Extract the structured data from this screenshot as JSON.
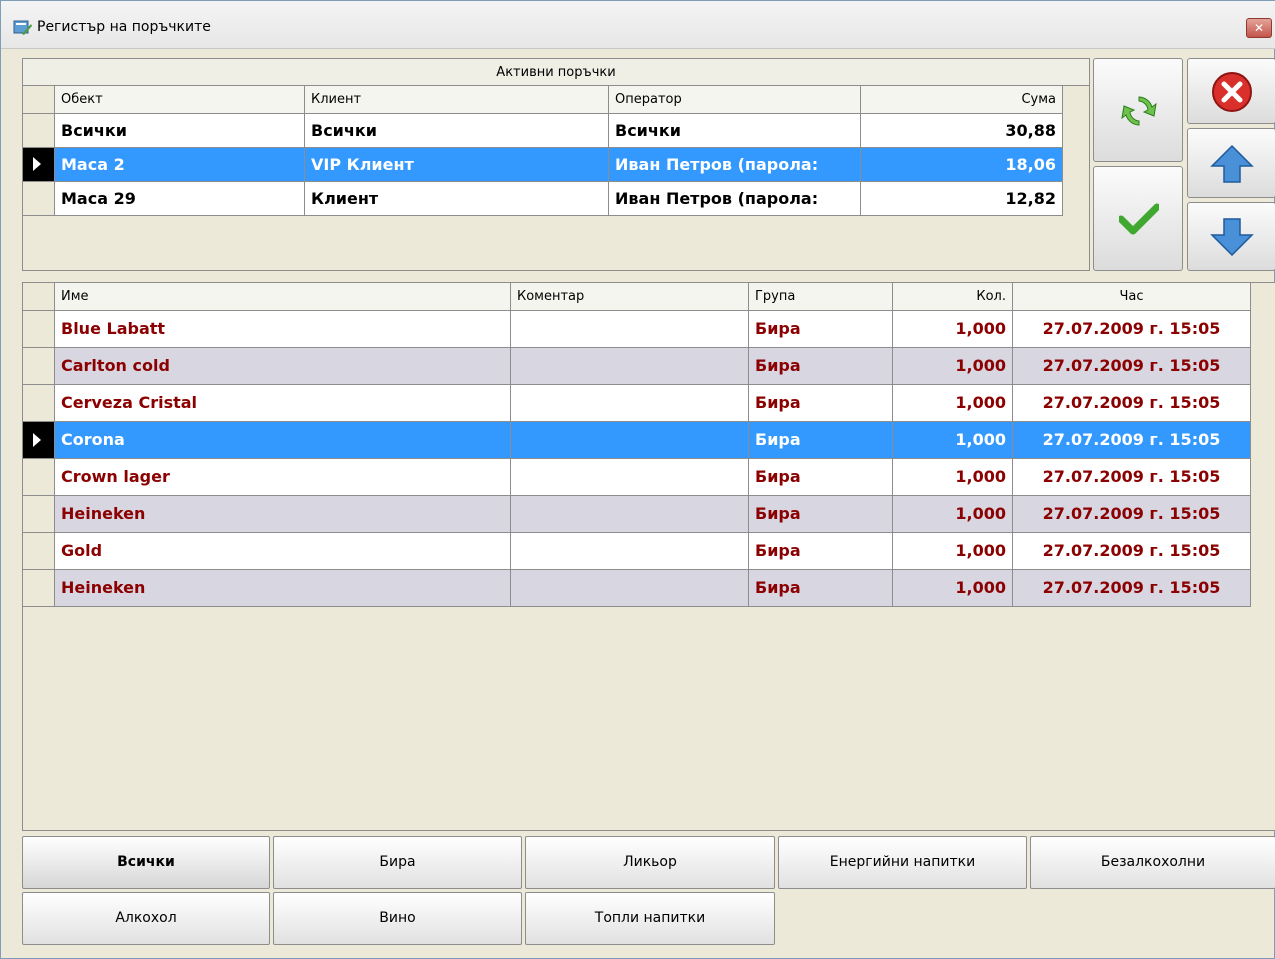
{
  "window": {
    "title": "Регистър на поръчките"
  },
  "orders": {
    "caption": "Активни поръчки",
    "headers": [
      "Обект",
      "Клиент",
      "Оператор",
      "Сума"
    ],
    "rows": [
      {
        "object": "Всички",
        "client": "Всички",
        "operator": "Всички",
        "sum": "30,88"
      },
      {
        "object": "Маса 2",
        "client": "VIP Клиент",
        "operator": "Иван Петров (парола:",
        "sum": "18,06"
      },
      {
        "object": "Маса 29",
        "client": "Клиент",
        "operator": "Иван Петров (парола:",
        "sum": "12,82"
      }
    ]
  },
  "items": {
    "headers": [
      "Име",
      "Коментар",
      "Група",
      "Кол.",
      "Час"
    ],
    "rows": [
      {
        "name": "Blue Labatt",
        "comment": "",
        "group": "Бира",
        "qty": "1,000",
        "time": "27.07.2009 г. 15:05"
      },
      {
        "name": "Carlton cold",
        "comment": "",
        "group": "Бира",
        "qty": "1,000",
        "time": "27.07.2009 г. 15:05"
      },
      {
        "name": "Cerveza Cristal",
        "comment": "",
        "group": "Бира",
        "qty": "1,000",
        "time": "27.07.2009 г. 15:05"
      },
      {
        "name": "Corona",
        "comment": "",
        "group": "Бира",
        "qty": "1,000",
        "time": "27.07.2009 г. 15:05"
      },
      {
        "name": "Crown lager",
        "comment": "",
        "group": "Бира",
        "qty": "1,000",
        "time": "27.07.2009 г. 15:05"
      },
      {
        "name": "Heineken",
        "comment": "",
        "group": "Бира",
        "qty": "1,000",
        "time": "27.07.2009 г. 15:05"
      },
      {
        "name": "Gold",
        "comment": "",
        "group": "Бира",
        "qty": "1,000",
        "time": "27.07.2009 г. 15:05"
      },
      {
        "name": "Heineken",
        "comment": "",
        "group": "Бира",
        "qty": "1,000",
        "time": "27.07.2009 г. 15:05"
      }
    ]
  },
  "categories": [
    "Всички",
    "Бира",
    "Ликьор",
    "Енергийни напитки",
    "Безалкохолни",
    "Алкохол",
    "Вино",
    "Топли напитки"
  ],
  "colors": {
    "selection": "#3399ff",
    "item_text": "#8b0000",
    "even_row": "#d8d6e1"
  },
  "icons": [
    "refresh-icon",
    "cancel-icon",
    "arrow-up-icon",
    "checkmark-icon",
    "arrow-down-icon"
  ]
}
